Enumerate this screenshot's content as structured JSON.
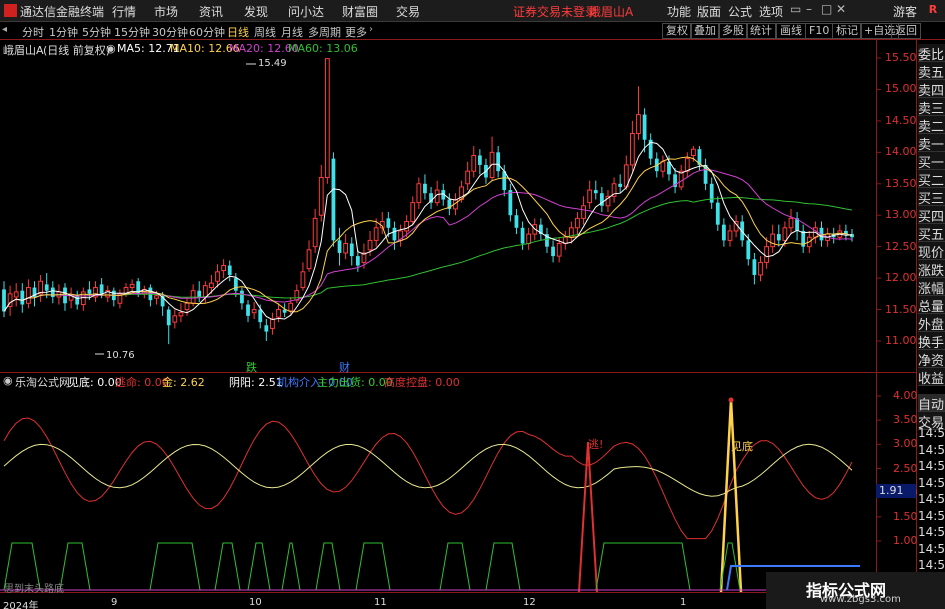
{
  "topbar": {
    "app_name": "通达信金融终端",
    "menu": [
      "行情",
      "市场",
      "资讯",
      "发现",
      "问小达",
      "财富圈",
      "交易"
    ],
    "notice": "证券交易未登录",
    "stock_name": "峨眉山A",
    "right_menu": [
      "功能",
      "版面",
      "公式",
      "选项"
    ],
    "guest": "游客",
    "r_badge": "R"
  },
  "periodbar": {
    "periods": [
      "分时",
      "1分钟",
      "5分钟",
      "15分钟",
      "30分钟",
      "60分钟",
      "日线",
      "周线",
      "月线",
      "多周期",
      "更多"
    ],
    "active": "日线",
    "tools": [
      "复权",
      "叠加",
      "多股",
      "统计",
      "画线",
      "F10",
      "标记",
      "+自选",
      "返回"
    ]
  },
  "main_info": {
    "title": "峨眉山A",
    "subtitle": "(日线 前复权)",
    "ma5": "MA5: 12.71",
    "ma10": "MA10: 12.66",
    "ma20": "MA20: 12.60",
    "ma60": "MA60: 13.06"
  },
  "indicator_info": {
    "name": "乐淘公式网",
    "items": [
      {
        "text": "见底: 0.00",
        "color": "#ffffff"
      },
      {
        "text": "逃命: 0.00",
        "color": "#e03030"
      },
      {
        "text": "金: 2.62",
        "color": "#ffd24a"
      },
      {
        "text": "阴阳: 2.51",
        "color": "#ffffff"
      },
      {
        "text": "机构介入: 0.00",
        "color": "#3a7bff"
      },
      {
        "text": "主力出货: 0.00",
        "color": "#30d030"
      },
      {
        "text": "高度控盘: 0.00",
        "color": "#e03030"
      }
    ]
  },
  "price_axis": [
    "15.50",
    "15.00",
    "14.50",
    "14.00",
    "13.50",
    "13.00",
    "12.50",
    "12.00",
    "11.50",
    "11.00"
  ],
  "indicator_axis": [
    "4.00",
    "3.50",
    "3.00",
    "2.50",
    "2.00",
    "1.50",
    "1.00"
  ],
  "indicator_value_box": "1.91",
  "side_panel": [
    "委比",
    "卖五",
    "卖四",
    "卖三",
    "卖二",
    "卖一",
    "买一",
    "买二",
    "买三",
    "买四",
    "买五",
    "现价",
    "涨跌",
    "涨幅",
    "总量",
    "外盘",
    "换手",
    "净资",
    "收益",
    "自动",
    "交易"
  ],
  "side_times": [
    "14:56",
    "14:56",
    "14:56",
    "14:56",
    "14:56",
    "14:56",
    "14:56",
    "14:56",
    "14:56"
  ],
  "x_axis": [
    {
      "label": "2024年"
    },
    {
      "label": "9"
    },
    {
      "label": "10"
    },
    {
      "label": "11"
    },
    {
      "label": "12"
    },
    {
      "label": "1"
    }
  ],
  "annotations": {
    "high": "15.49",
    "low": "10.76",
    "fall": "跌",
    "rich": "财",
    "dong": "逃!",
    "jiandi": "见底"
  },
  "bottom_text": "思到末头路底",
  "watermark": {
    "line1": "指标公式网",
    "line2": "www.zbgs3.com"
  },
  "colors": {
    "up": "#ff3b3b",
    "down": "#40e0e8",
    "ma5": "#ffffff",
    "ma10": "#ffd24a",
    "ma20": "#d040d0",
    "ma60": "#30c030",
    "grid": "#8b1a1a"
  },
  "chart_data": {
    "type": "candlestick",
    "price_range": [
      10.6,
      15.8
    ],
    "candles": [
      [
        11.82,
        11.47,
        11.95,
        11.38
      ],
      [
        11.55,
        11.75,
        11.88,
        11.4
      ],
      [
        11.7,
        11.78,
        11.92,
        11.55
      ],
      [
        11.8,
        11.58,
        11.92,
        11.45
      ],
      [
        11.6,
        11.85,
        11.98,
        11.52
      ],
      [
        11.85,
        11.7,
        11.95,
        11.55
      ],
      [
        11.75,
        11.95,
        12.05,
        11.62
      ],
      [
        11.9,
        11.8,
        12.08,
        11.68
      ],
      [
        11.85,
        11.7,
        11.95,
        11.6
      ],
      [
        11.7,
        11.78,
        11.9,
        11.58
      ],
      [
        11.85,
        11.6,
        11.92,
        11.48
      ],
      [
        11.65,
        11.72,
        11.85,
        11.52
      ],
      [
        11.72,
        11.58,
        11.8,
        11.5
      ],
      [
        11.58,
        11.78,
        11.85,
        11.48
      ],
      [
        11.82,
        11.75,
        11.95,
        11.65
      ],
      [
        11.7,
        11.85,
        11.95,
        11.62
      ],
      [
        11.9,
        11.75,
        12.0,
        11.68
      ],
      [
        11.7,
        11.8,
        11.88,
        11.62
      ],
      [
        11.8,
        11.65,
        11.85,
        11.55
      ],
      [
        11.6,
        11.75,
        11.82,
        11.52
      ],
      [
        11.75,
        11.85,
        11.92,
        11.7
      ],
      [
        11.85,
        11.9,
        11.98,
        11.78
      ],
      [
        11.95,
        11.75,
        12.0,
        11.7
      ],
      [
        11.75,
        11.82,
        11.88,
        11.68
      ],
      [
        11.85,
        11.65,
        11.9,
        11.55
      ],
      [
        11.68,
        11.72,
        11.8,
        11.58
      ],
      [
        11.72,
        11.55,
        11.78,
        11.4
      ],
      [
        11.5,
        11.25,
        11.55,
        10.95
      ],
      [
        11.3,
        11.4,
        11.5,
        11.2
      ],
      [
        11.4,
        11.45,
        11.6,
        11.3
      ],
      [
        11.5,
        11.6,
        11.7,
        11.4
      ],
      [
        11.6,
        11.8,
        11.9,
        11.55
      ],
      [
        11.8,
        11.7,
        11.95,
        11.62
      ],
      [
        11.7,
        11.88,
        11.95,
        11.6
      ],
      [
        11.85,
        11.92,
        12.05,
        11.75
      ],
      [
        11.95,
        12.1,
        12.22,
        11.85
      ],
      [
        12.12,
        12.2,
        12.3,
        12.0
      ],
      [
        12.2,
        12.05,
        12.28,
        11.95
      ],
      [
        12.0,
        11.8,
        12.08,
        11.7
      ],
      [
        11.8,
        11.6,
        11.85,
        11.5
      ],
      [
        11.58,
        11.4,
        11.65,
        11.3
      ],
      [
        11.45,
        11.5,
        11.62,
        11.35
      ],
      [
        11.5,
        11.3,
        11.58,
        11.2
      ],
      [
        11.25,
        11.15,
        11.35,
        11.0
      ],
      [
        11.2,
        11.35,
        11.45,
        11.1
      ],
      [
        11.38,
        11.5,
        11.6,
        11.3
      ],
      [
        11.5,
        11.45,
        11.6,
        11.38
      ],
      [
        11.48,
        11.6,
        11.7,
        11.4
      ],
      [
        11.65,
        11.8,
        11.9,
        11.6
      ],
      [
        11.85,
        12.1,
        12.25,
        11.8
      ],
      [
        12.15,
        12.45,
        12.6,
        12.1
      ],
      [
        12.5,
        12.95,
        13.1,
        12.4
      ],
      [
        13.0,
        13.6,
        13.8,
        12.9
      ],
      [
        13.6,
        15.49,
        15.49,
        13.5
      ],
      [
        13.9,
        12.6,
        14.0,
        12.5
      ],
      [
        12.6,
        12.4,
        12.8,
        12.2
      ],
      [
        12.4,
        12.55,
        12.7,
        12.3
      ],
      [
        12.55,
        12.35,
        12.65,
        12.2
      ],
      [
        12.35,
        12.2,
        12.45,
        12.1
      ],
      [
        12.25,
        12.4,
        12.55,
        12.15
      ],
      [
        12.45,
        12.6,
        12.75,
        12.35
      ],
      [
        12.6,
        12.8,
        12.95,
        12.5
      ],
      [
        12.8,
        12.9,
        13.05,
        12.7
      ],
      [
        12.95,
        12.8,
        13.05,
        12.65
      ],
      [
        12.8,
        12.6,
        12.9,
        12.45
      ],
      [
        12.6,
        12.75,
        12.85,
        12.5
      ],
      [
        12.75,
        12.9,
        13.0,
        12.65
      ],
      [
        12.9,
        13.2,
        13.3,
        12.85
      ],
      [
        13.2,
        13.5,
        13.6,
        13.1
      ],
      [
        13.5,
        13.35,
        13.65,
        13.25
      ],
      [
        13.35,
        13.2,
        13.45,
        13.1
      ],
      [
        13.2,
        13.4,
        13.55,
        13.15
      ],
      [
        13.4,
        13.25,
        13.5,
        13.15
      ],
      [
        13.25,
        13.1,
        13.35,
        13.0
      ],
      [
        13.1,
        13.25,
        13.35,
        13.0
      ],
      [
        13.25,
        13.45,
        13.55,
        13.2
      ],
      [
        13.5,
        13.7,
        13.85,
        13.4
      ],
      [
        13.7,
        13.95,
        14.1,
        13.6
      ],
      [
        13.95,
        13.8,
        14.05,
        13.65
      ],
      [
        13.8,
        13.6,
        13.9,
        13.5
      ],
      [
        13.6,
        14.0,
        14.25,
        13.55
      ],
      [
        14.0,
        13.7,
        14.1,
        13.6
      ],
      [
        13.7,
        13.4,
        13.8,
        13.3
      ],
      [
        13.4,
        13.0,
        13.5,
        12.9
      ],
      [
        13.0,
        12.8,
        13.1,
        12.7
      ],
      [
        12.8,
        12.55,
        12.9,
        12.45
      ],
      [
        12.55,
        12.7,
        12.8,
        12.45
      ],
      [
        12.7,
        12.85,
        12.95,
        12.6
      ],
      [
        12.85,
        12.7,
        12.95,
        12.6
      ],
      [
        12.7,
        12.5,
        12.8,
        12.4
      ],
      [
        12.5,
        12.35,
        12.6,
        12.25
      ],
      [
        12.35,
        12.55,
        12.65,
        12.25
      ],
      [
        12.55,
        12.65,
        12.75,
        12.45
      ],
      [
        12.65,
        12.8,
        12.9,
        12.55
      ],
      [
        12.8,
        12.95,
        13.05,
        12.7
      ],
      [
        12.95,
        13.15,
        13.3,
        12.85
      ],
      [
        13.2,
        13.4,
        13.55,
        13.1
      ],
      [
        13.4,
        13.35,
        13.55,
        13.25
      ],
      [
        13.35,
        13.15,
        13.45,
        13.05
      ],
      [
        13.15,
        13.3,
        13.4,
        13.05
      ],
      [
        13.3,
        13.5,
        13.6,
        13.2
      ],
      [
        13.5,
        13.45,
        13.65,
        13.35
      ],
      [
        13.45,
        13.8,
        13.95,
        13.4
      ],
      [
        13.8,
        14.3,
        14.5,
        13.7
      ],
      [
        14.3,
        14.6,
        15.05,
        14.2
      ],
      [
        14.6,
        14.2,
        14.7,
        14.0
      ],
      [
        14.2,
        13.9,
        14.3,
        13.8
      ],
      [
        13.9,
        13.7,
        14.0,
        13.6
      ],
      [
        13.7,
        13.85,
        13.95,
        13.6
      ],
      [
        13.85,
        13.65,
        13.95,
        13.55
      ],
      [
        13.65,
        13.45,
        13.75,
        13.35
      ],
      [
        13.45,
        13.7,
        13.8,
        13.4
      ],
      [
        13.7,
        13.9,
        14.0,
        13.6
      ],
      [
        13.95,
        14.05,
        14.1,
        13.85
      ],
      [
        14.05,
        13.8,
        14.1,
        13.7
      ],
      [
        13.8,
        13.5,
        13.9,
        13.4
      ],
      [
        13.5,
        13.2,
        13.6,
        13.1
      ],
      [
        13.2,
        12.85,
        13.3,
        12.75
      ],
      [
        12.85,
        12.6,
        12.95,
        12.5
      ],
      [
        12.6,
        12.75,
        12.85,
        12.5
      ],
      [
        12.75,
        12.9,
        13.0,
        12.65
      ],
      [
        12.9,
        12.6,
        13.0,
        12.5
      ],
      [
        12.6,
        12.3,
        12.7,
        12.2
      ],
      [
        12.3,
        12.05,
        12.4,
        11.9
      ],
      [
        12.05,
        12.25,
        12.35,
        11.95
      ],
      [
        12.25,
        12.5,
        12.65,
        12.15
      ],
      [
        12.5,
        12.7,
        12.85,
        12.4
      ],
      [
        12.7,
        12.6,
        12.85,
        12.5
      ],
      [
        12.6,
        12.8,
        12.9,
        12.5
      ],
      [
        12.8,
        12.95,
        13.1,
        12.7
      ],
      [
        12.95,
        12.75,
        13.05,
        12.6
      ],
      [
        12.75,
        12.5,
        12.85,
        12.4
      ],
      [
        12.5,
        12.65,
        12.75,
        12.4
      ],
      [
        12.65,
        12.8,
        12.9,
        12.55
      ],
      [
        12.8,
        12.6,
        12.9,
        12.5
      ],
      [
        12.6,
        12.7,
        12.8,
        12.5
      ],
      [
        12.7,
        12.65,
        12.8,
        12.55
      ],
      [
        12.65,
        12.75,
        12.85,
        12.6
      ],
      [
        12.75,
        12.7,
        12.85,
        12.6
      ],
      [
        12.7,
        12.65,
        12.78,
        12.58
      ]
    ]
  }
}
